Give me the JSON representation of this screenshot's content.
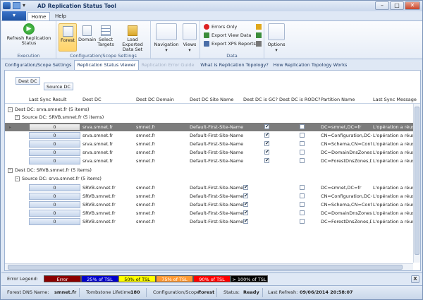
{
  "app": {
    "title": "AD Replication Status Tool"
  },
  "ribbon": {
    "tabs": [
      "Home",
      "Help"
    ],
    "refresh_label": "Refresh Replication Status",
    "execution_label": "Execution",
    "forest": "Forest",
    "domain": "Domain",
    "select_targets": "Select Targets",
    "load_exported": "Load Exported Data Set",
    "config_scope_label": "Configuration/Scope Settings",
    "navigation": "Navigation",
    "views": "Views",
    "errors_only": "Errors Only",
    "export_view": "Export View Data",
    "export_xps": "Export XPS Reports",
    "data_label": "Data",
    "options": "Options"
  },
  "page_tabs": [
    "Configuration/Scope Settings",
    "Replication Status Viewer",
    "Replication Error Guide",
    "What is Replication Topology?",
    "How Replication Topology Works"
  ],
  "grouping": {
    "chip1": "Dest DC",
    "chip2": "Source DC"
  },
  "columns": [
    "Last Sync Result",
    "Dest DC",
    "Dest DC Domain",
    "Dest DC Site Name",
    "Dest DC is GC?",
    "Dest DC is RODC?",
    "Partition Name",
    "Last Sync Message"
  ],
  "groups": [
    {
      "label": "Dest DC: srva.smnet.fr (5 items)",
      "sub": "Source DC: SRVB.smnet.fr (5 items)",
      "rows": [
        {
          "result": "0",
          "dc": "srva.smnet.fr",
          "domain": "smnet.fr",
          "site": "Default-First-Site-Name",
          "gc": "✔",
          "rodc": "",
          "partition": "DC=smnet,DC=fr",
          "msg": "L'opération a réussi"
        },
        {
          "result": "0",
          "dc": "srva.smnet.fr",
          "domain": "smnet.fr",
          "site": "Default-First-Site-Name",
          "gc": "✔",
          "rodc": "",
          "partition": "CN=Configuration,DC=...",
          "msg": "L'opération a réussi"
        },
        {
          "result": "0",
          "dc": "srva.smnet.fr",
          "domain": "smnet.fr",
          "site": "Default-First-Site-Name",
          "gc": "✔",
          "rodc": "",
          "partition": "CN=Schema,CN=Config...",
          "msg": "L'opération a réussi"
        },
        {
          "result": "0",
          "dc": "srva.smnet.fr",
          "domain": "smnet.fr",
          "site": "Default-First-Site-Name",
          "gc": "✔",
          "rodc": "",
          "partition": "DC=DomainDnsZones,...",
          "msg": "L'opération a réussi"
        },
        {
          "result": "0",
          "dc": "srva.smnet.fr",
          "domain": "smnet.fr",
          "site": "Default-First-Site-Name",
          "gc": "✔",
          "rodc": "",
          "partition": "DC=ForestDnsZones,D...",
          "msg": "L'opération a réussi"
        }
      ]
    },
    {
      "label": "Dest DC: SRVB.smnet.fr (5 items)",
      "sub": "Source DC: srva.smnet.fr (5 items)",
      "rows": [
        {
          "result": "0",
          "dc": "SRVB.smnet.fr",
          "domain": "smnet.fr",
          "site": "Default-First-Site-Name",
          "gc": "✔",
          "rodc": "",
          "partition": "DC=smnet,DC=fr",
          "msg": "L'opération a réussi"
        },
        {
          "result": "0",
          "dc": "SRVB.smnet.fr",
          "domain": "smnet.fr",
          "site": "Default-First-Site-Name",
          "gc": "✔",
          "rodc": "",
          "partition": "CN=Configuration,DC=...",
          "msg": "L'opération a réussi"
        },
        {
          "result": "0",
          "dc": "SRVB.smnet.fr",
          "domain": "smnet.fr",
          "site": "Default-First-Site-Name",
          "gc": "✔",
          "rodc": "",
          "partition": "CN=Schema,CN=Config...",
          "msg": "L'opération a réussi"
        },
        {
          "result": "0",
          "dc": "SRVB.smnet.fr",
          "domain": "smnet.fr",
          "site": "Default-First-Site-Name",
          "gc": "✔",
          "rodc": "",
          "partition": "DC=DomainDnsZones,...",
          "msg": "L'opération a réussi"
        },
        {
          "result": "0",
          "dc": "SRVB.smnet.fr",
          "domain": "smnet.fr",
          "site": "Default-First-Site-Name",
          "gc": "✔",
          "rodc": "",
          "partition": "DC=ForestDnsZones,D...",
          "msg": "L'opération a réussi"
        }
      ]
    }
  ],
  "legend": {
    "label": "Error Legend:",
    "items": [
      {
        "text": "Error",
        "bg": "#8b0000",
        "fg": "#ffffff"
      },
      {
        "text": "25% of TSL",
        "bg": "#0000cc",
        "fg": "#ffffff"
      },
      {
        "text": "50% of TSL",
        "bg": "#ffff00",
        "fg": "#000000"
      },
      {
        "text": "75% of TSL",
        "bg": "#ff9933",
        "fg": "#ffffff"
      },
      {
        "text": "90% of TSL",
        "bg": "#ff0000",
        "fg": "#ffffff"
      },
      {
        "text": "> 100% of TSL",
        "bg": "#000000",
        "fg": "#ffffff"
      }
    ],
    "close": "X"
  },
  "status": {
    "forest_label": "Forest DNS Name:",
    "forest": "smnet.fr",
    "tombstone_label": "Tombstone Lifetime:",
    "tombstone": "180",
    "scope_label": "Configuration/Scope:",
    "scope": "Forest",
    "status_label": "Status:",
    "status": "Ready",
    "refresh_label": "Last Refresh:",
    "refresh": "09/06/2014 20:58:07"
  }
}
